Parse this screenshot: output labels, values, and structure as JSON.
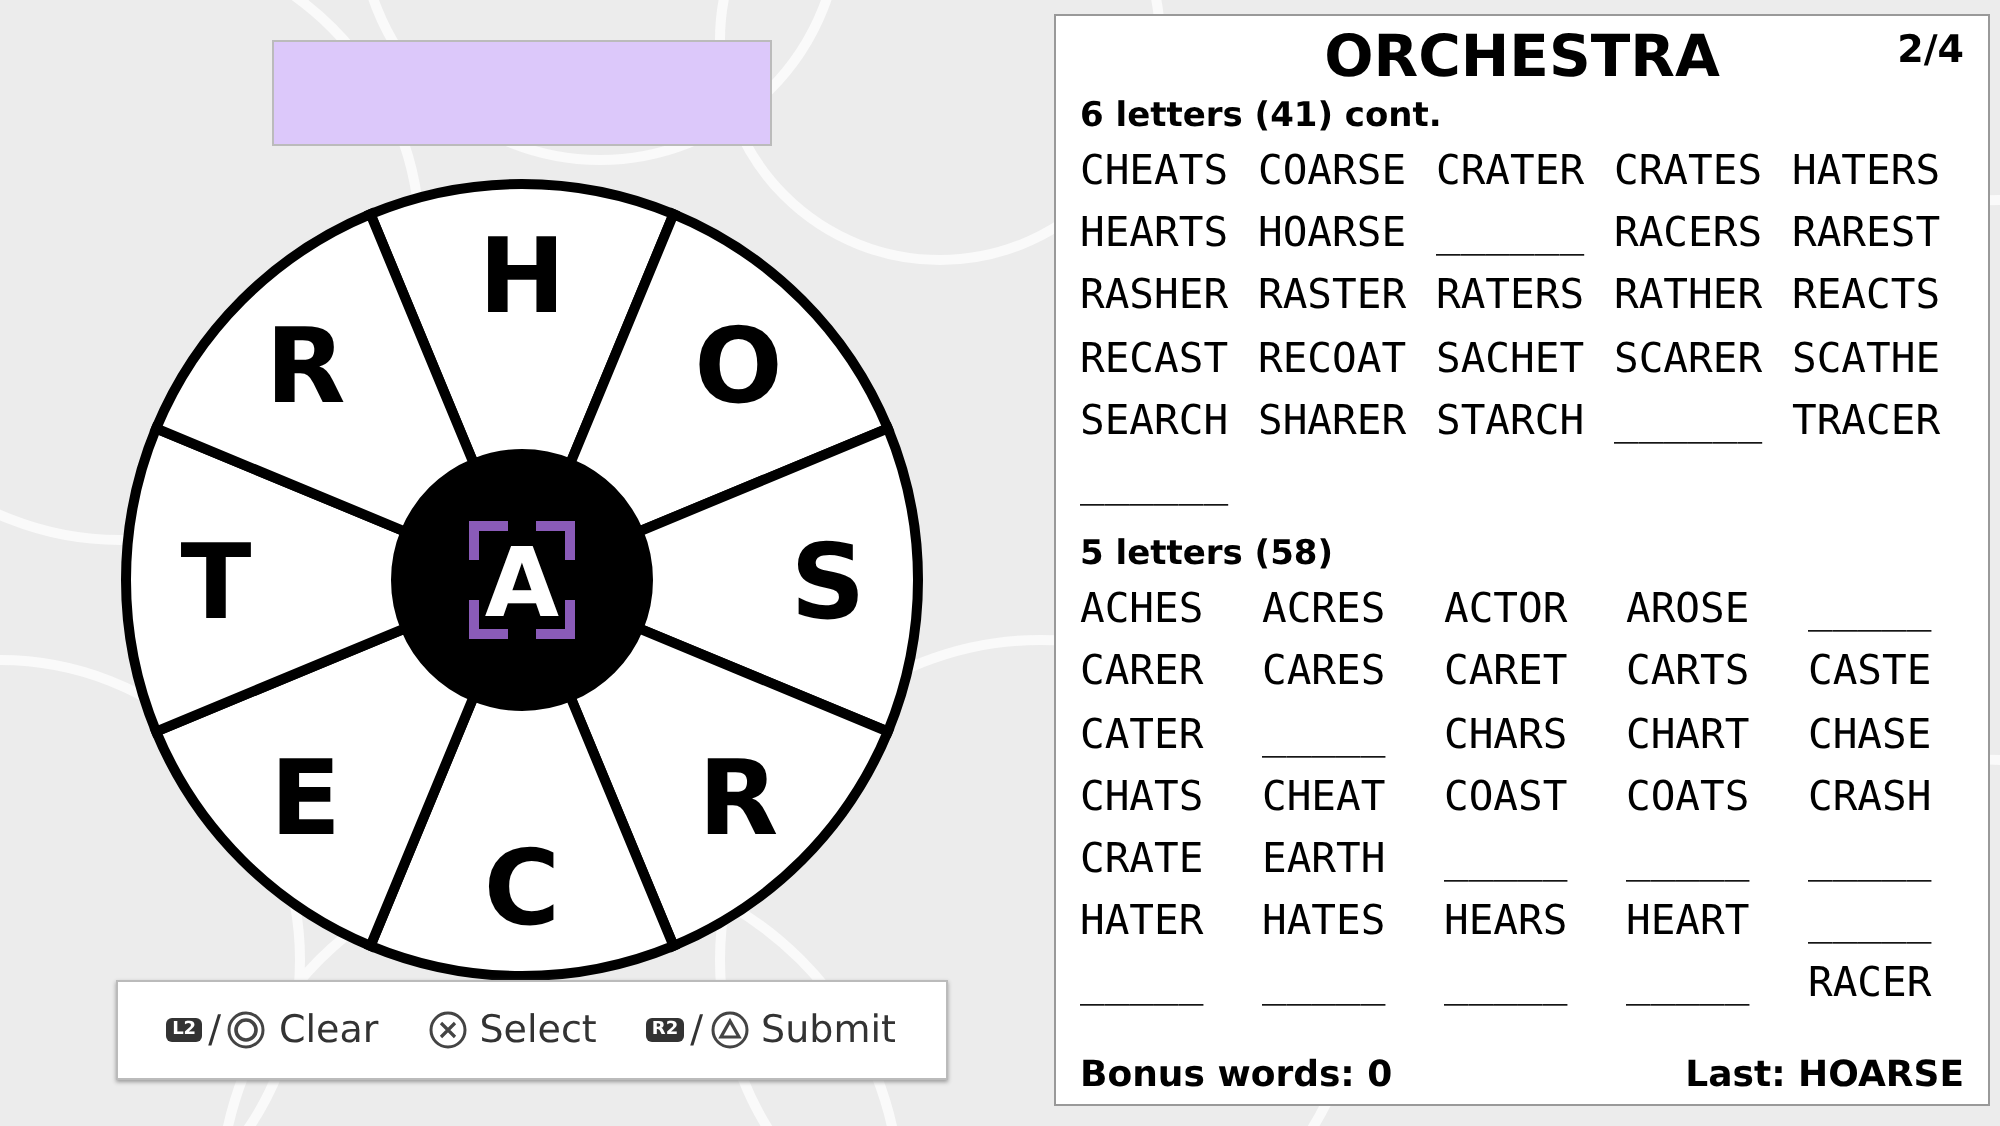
{
  "entry": {
    "selected": true
  },
  "wheel": {
    "letters": [
      "H",
      "O",
      "S",
      "R",
      "C",
      "E",
      "T",
      "R"
    ],
    "center": {
      "letter": "A",
      "selected": true
    }
  },
  "controls": [
    {
      "kind": "circle",
      "badge": "L2",
      "separator": "/",
      "label": "Clear"
    },
    {
      "kind": "cross",
      "label": "Select"
    },
    {
      "kind": "triangle",
      "badge": "R2",
      "separator": "/",
      "label": "Submit"
    }
  ],
  "panel": {
    "title": "ORCHESTRA",
    "page": "2/4",
    "sections": [
      {
        "heading": "6 letters (41) cont.",
        "words": [
          "CHEATS",
          "COARSE",
          "CRATER",
          "CRATES",
          "HATERS",
          "HEARTS",
          "HOARSE",
          "______",
          "RACERS",
          "RAREST",
          "RASHER",
          "RASTER",
          "RATERS",
          "RATHER",
          "REACTS",
          "RECAST",
          "RECOAT",
          "SACHET",
          "SCARER",
          "SCATHE",
          "SEARCH",
          "SHARER",
          "STARCH",
          "______",
          "TRACER",
          "______"
        ]
      },
      {
        "heading": "5 letters (58)",
        "words": [
          "ACHES",
          "ACRES",
          "ACTOR",
          "AROSE",
          "_____",
          "CARER",
          "CARES",
          "CARET",
          "CARTS",
          "CASTE",
          "CATER",
          "_____",
          "CHARS",
          "CHART",
          "CHASE",
          "CHATS",
          "CHEAT",
          "COAST",
          "COATS",
          "CRASH",
          "CRATE",
          "EARTH",
          "_____",
          "_____",
          "_____",
          "HATER",
          "HATES",
          "HEARS",
          "HEART",
          "_____",
          "_____",
          "_____",
          "_____",
          "_____",
          "RACER"
        ]
      }
    ],
    "bonus": "Bonus words: 0",
    "last": "Last: HOARSE"
  }
}
